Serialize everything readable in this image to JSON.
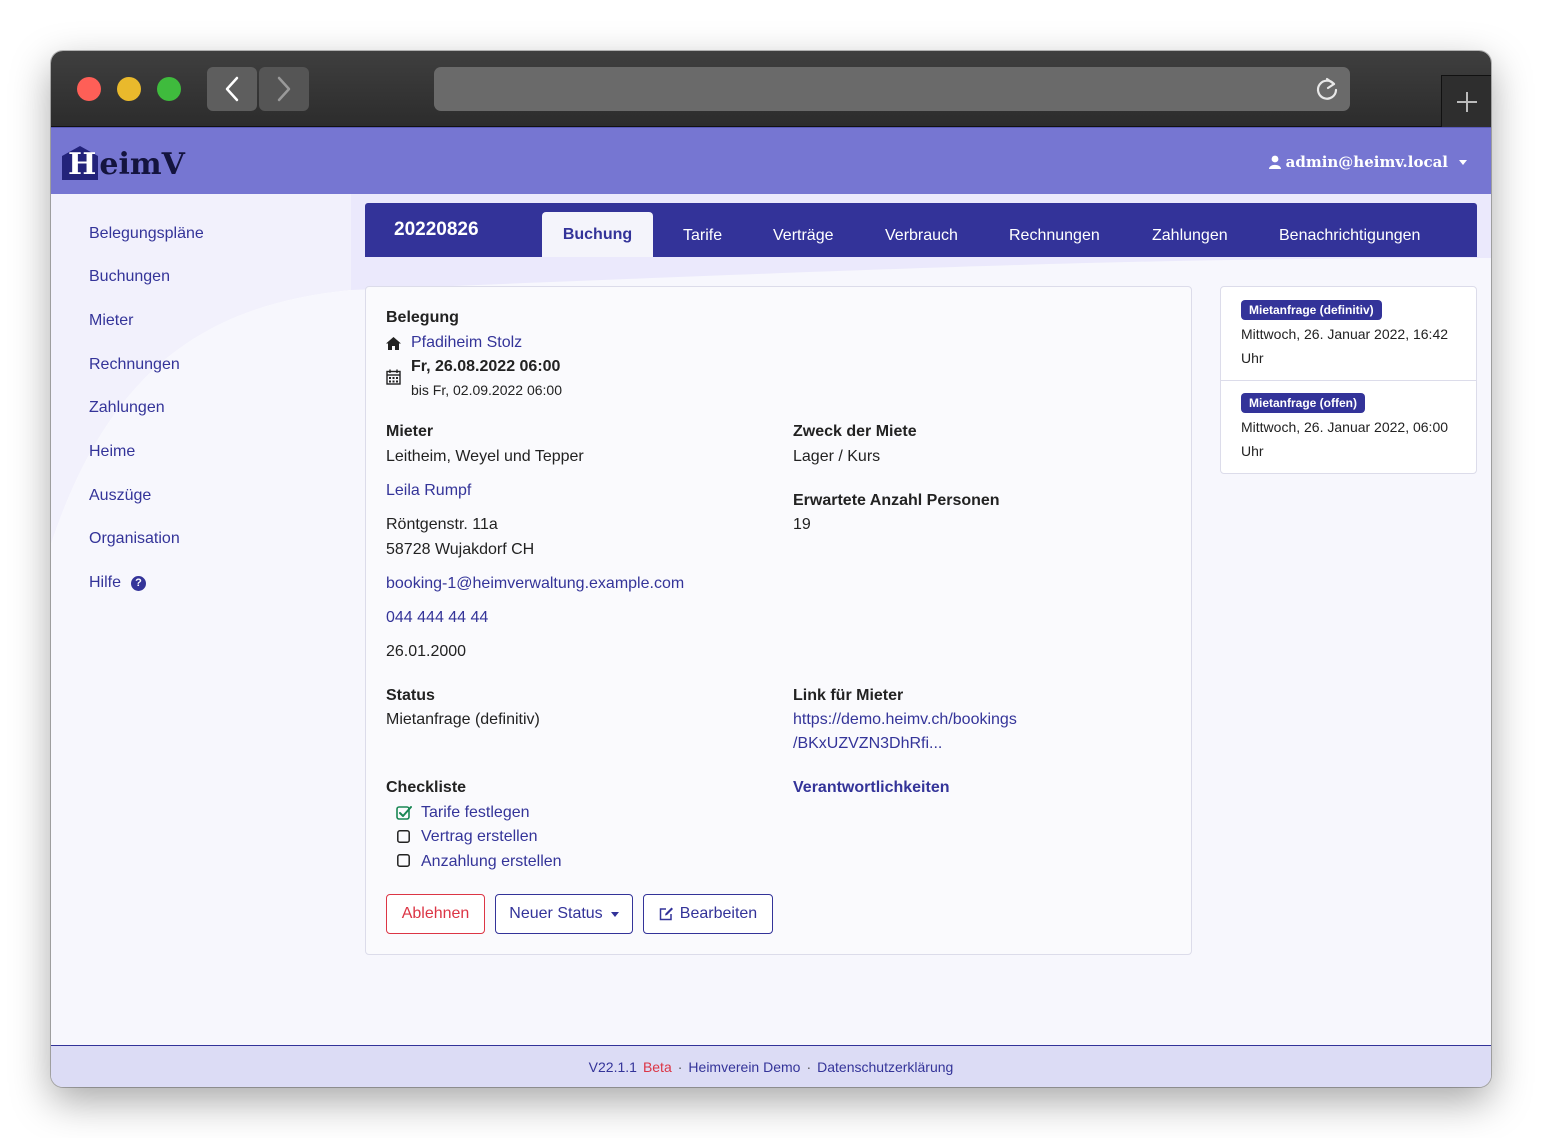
{
  "app": {
    "name_first_letter": "H",
    "name_rest": "eimV",
    "user": "admin@heimv.local"
  },
  "sidebar": {
    "items": [
      {
        "label": "Belegungspläne"
      },
      {
        "label": "Buchungen"
      },
      {
        "label": "Mieter"
      },
      {
        "label": "Rechnungen"
      },
      {
        "label": "Zahlungen"
      },
      {
        "label": "Heime"
      },
      {
        "label": "Auszüge"
      },
      {
        "label": "Organisation"
      },
      {
        "label": "Hilfe"
      }
    ],
    "help_icon_glyph": "?"
  },
  "tabs": {
    "booking_id": "20220826",
    "items": [
      {
        "label": "Buchung"
      },
      {
        "label": "Tarife"
      },
      {
        "label": "Verträge"
      },
      {
        "label": "Verbrauch"
      },
      {
        "label": "Rechnungen"
      },
      {
        "label": "Zahlungen"
      },
      {
        "label": "Benachrichtigungen"
      }
    ]
  },
  "booking": {
    "occupancy_label": "Belegung",
    "home": "Pfadiheim Stolz",
    "start": "Fr, 26.08.2022 06:00",
    "end": "bis Fr, 02.09.2022 06:00",
    "tenant_label": "Mieter",
    "tenant_org": "Leitheim, Weyel und Tepper",
    "tenant_name": "Leila Rumpf",
    "street": "Röntgenstr. 11a",
    "city": "58728 Wujakdorf CH",
    "email": "booking-1@heimverwaltung.example.com",
    "phone": "044 444 44 44",
    "birthdate": "26.01.2000",
    "purpose_label": "Zweck der Miete",
    "purpose": "Lager / Kurs",
    "persons_label": "Erwartete Anzahl Personen",
    "persons": "19",
    "status_label": "Status",
    "status": "Mietanfrage (definitiv)",
    "tenant_link_label": "Link für Mieter",
    "tenant_link_line1": "https://demo.heimv.ch/bookings",
    "tenant_link_line2": "/BKxUZVZN3DhRfi...",
    "checklist_label": "Checkliste",
    "checklist": [
      {
        "label": "Tarife festlegen",
        "checked": true
      },
      {
        "label": "Vertrag erstellen",
        "checked": false
      },
      {
        "label": "Anzahlung erstellen",
        "checked": false
      }
    ],
    "responsibilities": "Verantwortlichkeiten"
  },
  "actions": {
    "reject": "Ablehnen",
    "new_status": "Neuer Status",
    "edit": "Bearbeiten"
  },
  "log": [
    {
      "badge": "Mietanfrage (definitiv)",
      "line1": "Mittwoch, 26. Januar 2022, 16:42",
      "line2": "Uhr"
    },
    {
      "badge": "Mietanfrage (offen)",
      "line1": "Mittwoch, 26. Januar 2022, 06:00",
      "line2": "Uhr"
    }
  ],
  "footer": {
    "version": "V22.1.1",
    "beta": "Beta",
    "separator": "·",
    "org": "Heimverein Demo",
    "privacy": "Datenschutzerklärung"
  },
  "colors": {
    "brand": "#333399",
    "nav": "#7676d2",
    "danger": "#dc3545",
    "success": "#198754"
  }
}
